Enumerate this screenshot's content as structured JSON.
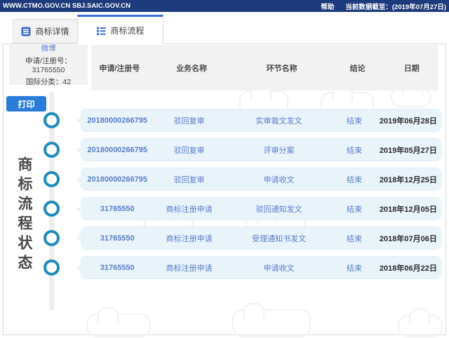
{
  "topbar": {
    "site_url": "WWW.CTMO.GOV.CN SBJ.SAIC.GOV.CN",
    "help_label": "帮助",
    "data_cutoff": "当前数据截至：(2019年07月27日)"
  },
  "tabs": [
    {
      "label": "商标详情",
      "active": false
    },
    {
      "label": "商标流程",
      "active": true
    }
  ],
  "info_box": {
    "trademark_name": "微博",
    "application_number": "申请/注册号：31765550",
    "intl_class": "国际分类：42"
  },
  "print_button_label": "打印",
  "vertical_title": "商标流程状态",
  "table": {
    "headers": [
      "申请/注册号",
      "业务名称",
      "环节名称",
      "结论",
      "日期"
    ],
    "rows": [
      [
        "20180000266795",
        "驳回复审",
        "实审裁文发文",
        "结束",
        "2019年06月28日"
      ],
      [
        "20180000266795",
        "驳回复审",
        "评审分案",
        "结束",
        "2019年05月27日"
      ],
      [
        "20180000266795",
        "驳回复审",
        "申请收文",
        "结束",
        "2018年12月25日"
      ],
      [
        "31765550",
        "商标注册申请",
        "驳回通知发文",
        "结束",
        "2018年12月05日"
      ],
      [
        "31765550",
        "商标注册申请",
        "受理通知书发文",
        "结束",
        "2018年07月06日"
      ],
      [
        "31765550",
        "商标注册申请",
        "申请收文",
        "结束",
        "2018年06月22日"
      ]
    ]
  },
  "colors": {
    "topbar_bg": "#1d3a7c",
    "accent_blue": "#3f6fd8",
    "print_button_bg": "#2b7cd9",
    "timeline_ring": "#1e8cba",
    "card_bg": "#e9f4fa",
    "link_text": "#5b7dc9"
  }
}
